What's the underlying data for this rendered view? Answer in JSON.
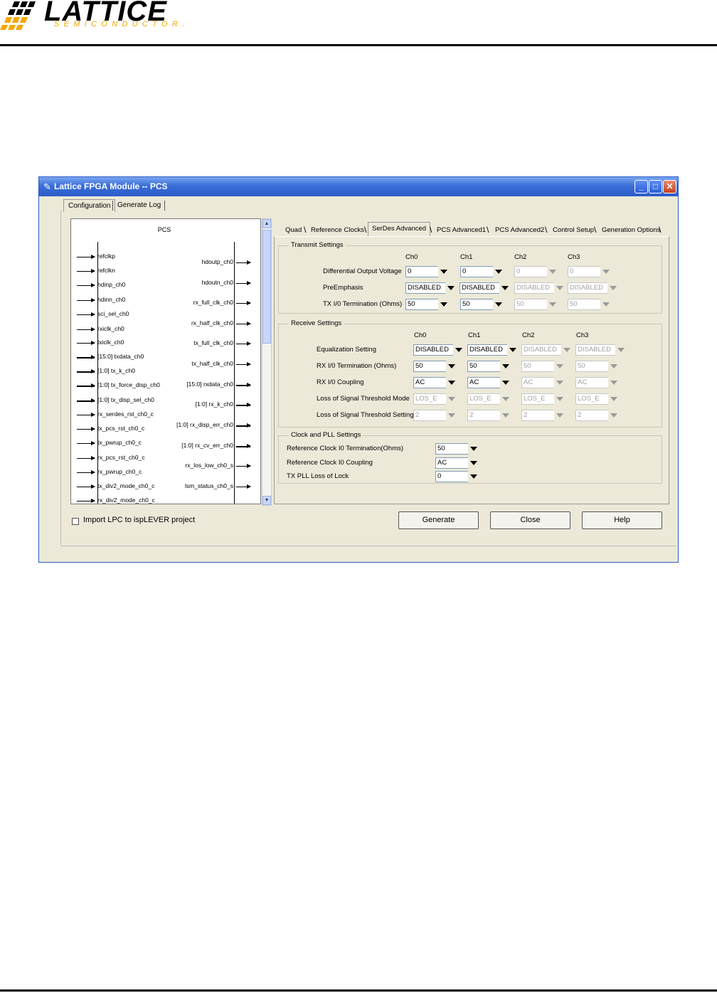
{
  "document": {
    "logo_text": "LATTICE",
    "logo_sub": "SEMICONDUCTOR.",
    "brand_orange": "#F5A800"
  },
  "window": {
    "title": "Lattice FPGA Module -- PCS",
    "title_icon": "feather-icon",
    "titlebar_color": "#2a5bc8",
    "minimize": "_",
    "maximize": "□",
    "close": "✕"
  },
  "top_tabs": [
    "Configuration",
    "Generate Log"
  ],
  "diagram": {
    "title": "PCS",
    "inputs": [
      "refclkp",
      "refclkn",
      "hdinp_ch0",
      "hdinn_ch0",
      "sci_sel_ch0",
      "rxiclk_ch0",
      "txiclk_ch0",
      "[15:0] txdata_ch0",
      "[1:0] tx_k_ch0",
      "[1:0] tx_force_disp_ch0",
      "[1:0] tx_disp_sel_ch0",
      "rx_serdes_rst_ch0_c",
      "tx_pcs_rst_ch0_c",
      "tx_pwrup_ch0_c",
      "rx_pcs_rst_ch0_c",
      "rx_pwrup_ch0_c",
      "tx_div2_mode_ch0_c",
      "rx_div2_mode_ch0_c"
    ],
    "outputs": [
      "hdoutp_ch0",
      "hdoutn_ch0",
      "rx_full_clk_ch0",
      "rx_half_clk_ch0",
      "tx_full_clk_ch0",
      "tx_half_clk_ch0",
      "[15:0] rxdata_ch0",
      "[1:0] rx_k_ch0",
      "[1:0] rx_disp_err_ch0",
      "[1:0] rx_cv_err_ch0",
      "rx_los_low_ch0_s",
      "lsm_status_ch0_s"
    ]
  },
  "right_tabs": [
    "Quad",
    "Reference Clocks",
    "SerDes Advanced",
    "PCS Advanced1",
    "PCS Advanced2",
    "Control Setup",
    "Generation Options"
  ],
  "right_tabs_active": "SerDes Advanced",
  "transmit": {
    "title": "Transmit Settings",
    "channels": [
      "Ch0",
      "Ch1",
      "Ch2",
      "Ch3"
    ],
    "rows": [
      {
        "label": "Differential Output Voltage",
        "values": [
          "0",
          "0",
          "0",
          "0"
        ]
      },
      {
        "label": "PreEmphasis",
        "values": [
          "DISABLED",
          "DISABLED",
          "DISABLED",
          "DISABLED"
        ]
      },
      {
        "label": "TX I/0 Termination (Ohms)",
        "values": [
          "50",
          "50",
          "50",
          "50"
        ]
      }
    ]
  },
  "receive": {
    "title": "Receive Settings",
    "channels": [
      "Ch0",
      "Ch1",
      "Ch2",
      "Ch3"
    ],
    "rows": [
      {
        "label": "Equalization Setting",
        "values": [
          "DISABLED",
          "DISABLED",
          "DISABLED",
          "DISABLED"
        ]
      },
      {
        "label": "RX I/0 Termination (Ohms)",
        "values": [
          "50",
          "50",
          "50",
          "50"
        ]
      },
      {
        "label": "RX I/0 Coupling",
        "values": [
          "AC",
          "AC",
          "AC",
          "AC"
        ]
      },
      {
        "label": "Loss of Signal Threshold Mode",
        "values": [
          "LOS_E",
          "LOS_E",
          "LOS_E",
          "LOS_E"
        ]
      },
      {
        "label": "Loss of Signal Threshold Setting",
        "values": [
          "2",
          "2",
          "2",
          "2"
        ]
      }
    ]
  },
  "clock_pll": {
    "title": "Clock and PLL Settings",
    "rows": [
      {
        "label": "Reference Clock I0 Termination(Ohms)",
        "value": "50"
      },
      {
        "label": "Reference Clock I0 Coupling",
        "value": "AC"
      },
      {
        "label": "TX PLL Loss of Lock",
        "value": "0"
      }
    ]
  },
  "import_checkbox": {
    "label": "Import LPC to ispLEVER project",
    "checked": false
  },
  "buttons": {
    "generate": "Generate",
    "close": "Close",
    "help": "Help"
  }
}
